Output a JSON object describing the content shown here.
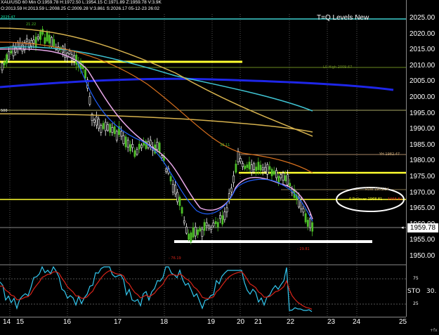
{
  "header": {
    "line1": "XAU/USD 60 Min  O:1959.78  H:1972.50  L:1954.15  C:1971.89  Z:1959.78  V:3.9K",
    "line2": "O:2013.59  H:2013.59  L:2008.25  C:2009.28  V:3.861  S:2026.17  05-12-23  26:02"
  },
  "study_title": "2025.47",
  "levels_title": "T=Q Levels New",
  "price_axis": {
    "ticks": [
      "2025.00",
      "2020.00",
      "2015.00",
      "2010.00",
      "2005.00",
      "2000.00",
      "1995.00",
      "1990.00",
      "1985.00",
      "1980.00",
      "1975.00",
      "1970.00",
      "1965.00",
      "1960.00",
      "1955.00",
      "1950.00"
    ],
    "last_price": "1959.78"
  },
  "time_axis": {
    "ticks": [
      "14",
      "15",
      "16",
      "17",
      "18",
      "19",
      "20",
      "21",
      "22",
      "23",
      "24",
      "25"
    ]
  },
  "annotations": {
    "high_label": "21.22",
    "mid_high": "32.11",
    "left_edge": "500",
    "lo_high": "L0 High 2009.67",
    "yh": "YH 1982.47",
    "r1": "R0W 1971.24",
    "rollover": "0 Rollover 1968.81",
    "rollover_val": "1968.81",
    "low_left": "- 76.19",
    "low_right": "- 29.81"
  },
  "oscillator": {
    "label": "STO",
    "value": "30.",
    "ticks": [
      "75",
      "25"
    ]
  },
  "misc": {
    "zoom_mark": "+fx"
  },
  "colors": {
    "bull": "#4cbf27",
    "bear": "#ffffff",
    "yellow": "#ffff30",
    "blue": "#1e26e8",
    "cyan": "#3fc3d2",
    "orange": "#d8701e",
    "tan": "#d6b24e",
    "pink": "#e9a8e9",
    "sto_main": "#33c8f0",
    "sto_signal": "#d8241a"
  }
}
